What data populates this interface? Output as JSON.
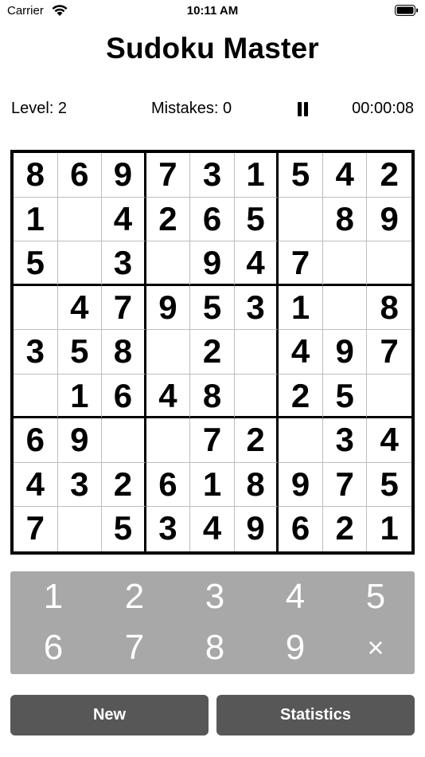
{
  "status_bar": {
    "carrier": "Carrier",
    "time": "10:11 AM"
  },
  "title": "Sudoku Master",
  "info": {
    "level": "Level: 2",
    "mistakes": "Mistakes: 0",
    "timer": "00:00:08"
  },
  "board": [
    [
      "8",
      "6",
      "9",
      "7",
      "3",
      "1",
      "5",
      "4",
      "2"
    ],
    [
      "1",
      "",
      "4",
      "2",
      "6",
      "5",
      "",
      "8",
      "9"
    ],
    [
      "5",
      "",
      "3",
      "",
      "9",
      "4",
      "7",
      "",
      ""
    ],
    [
      "",
      "4",
      "7",
      "9",
      "5",
      "3",
      "1",
      "",
      "8"
    ],
    [
      "3",
      "5",
      "8",
      "",
      "2",
      "",
      "4",
      "9",
      "7"
    ],
    [
      "",
      "1",
      "6",
      "4",
      "8",
      "",
      "2",
      "5",
      ""
    ],
    [
      "6",
      "9",
      "",
      "",
      "7",
      "2",
      "",
      "3",
      "4"
    ],
    [
      "4",
      "3",
      "2",
      "6",
      "1",
      "8",
      "9",
      "7",
      "5"
    ],
    [
      "7",
      "",
      "5",
      "3",
      "4",
      "9",
      "6",
      "2",
      "1"
    ]
  ],
  "keypad": [
    "1",
    "2",
    "3",
    "4",
    "5",
    "6",
    "7",
    "8",
    "9",
    "×"
  ],
  "buttons": {
    "new": "New",
    "statistics": "Statistics"
  }
}
